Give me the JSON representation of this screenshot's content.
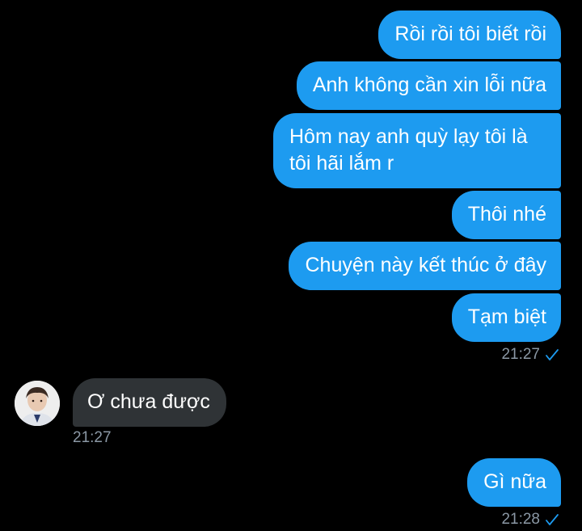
{
  "conversation": {
    "outgoing_group_1": [
      "Rồi rồi tôi biết rồi",
      "Anh không cần xin lỗi nữa",
      "Hôm nay anh quỳ lạy tôi là\ntôi hãi lắm r",
      "Thôi nhé",
      "Chuyện này kết thúc ở đây",
      "Tạm biệt"
    ],
    "outgoing_group_1_time": "21:27",
    "incoming": {
      "text": "Ơ chưa được",
      "time": "21:27"
    },
    "outgoing_group_2": [
      "Gì nữa"
    ],
    "outgoing_group_2_time": "21:28"
  },
  "colors": {
    "outgoing_bubble": "#1d9bf0",
    "incoming_bubble": "#2f3336",
    "background": "#000000",
    "timestamp": "#8b98a5",
    "read_check": "#1d9bf0"
  },
  "icons": {
    "read_receipt": "check-icon",
    "avatar": "user-avatar"
  }
}
